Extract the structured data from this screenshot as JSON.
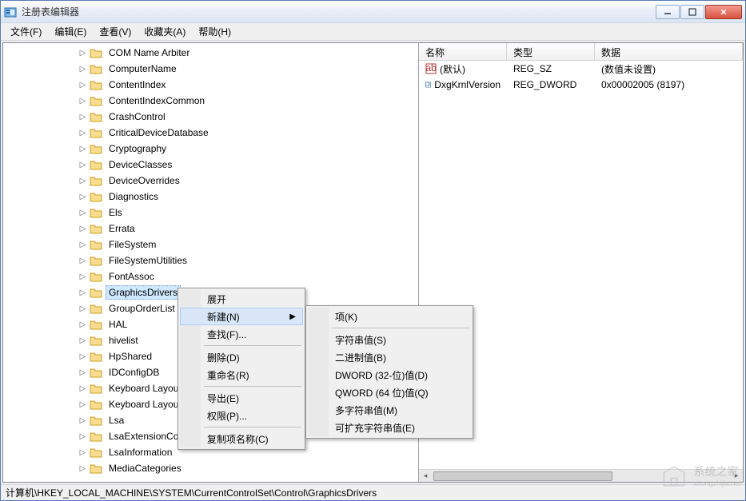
{
  "window": {
    "title": "注册表编辑器"
  },
  "menubar": [
    "文件(F)",
    "编辑(E)",
    "查看(V)",
    "收藏夹(A)",
    "帮助(H)"
  ],
  "tree": {
    "indent_base": 5,
    "items": [
      {
        "label": "COM Name Arbiter",
        "exp": false,
        "sel": false
      },
      {
        "label": "ComputerName",
        "exp": false,
        "sel": false
      },
      {
        "label": "ContentIndex",
        "exp": false,
        "sel": false
      },
      {
        "label": "ContentIndexCommon",
        "exp": false,
        "sel": false
      },
      {
        "label": "CrashControl",
        "exp": false,
        "sel": false
      },
      {
        "label": "CriticalDeviceDatabase",
        "exp": false,
        "sel": false
      },
      {
        "label": "Cryptography",
        "exp": false,
        "sel": false
      },
      {
        "label": "DeviceClasses",
        "exp": false,
        "sel": false
      },
      {
        "label": "DeviceOverrides",
        "exp": false,
        "sel": false
      },
      {
        "label": "Diagnostics",
        "exp": false,
        "sel": false
      },
      {
        "label": "Els",
        "exp": false,
        "sel": false
      },
      {
        "label": "Errata",
        "exp": false,
        "sel": false
      },
      {
        "label": "FileSystem",
        "exp": false,
        "sel": false
      },
      {
        "label": "FileSystemUtilities",
        "exp": false,
        "sel": false
      },
      {
        "label": "FontAssoc",
        "exp": false,
        "sel": false
      },
      {
        "label": "GraphicsDrivers",
        "exp": false,
        "sel": true
      },
      {
        "label": "GroupOrderList",
        "exp": false,
        "sel": false
      },
      {
        "label": "HAL",
        "exp": false,
        "sel": false
      },
      {
        "label": "hivelist",
        "exp": false,
        "sel": false
      },
      {
        "label": "HpShared",
        "exp": false,
        "sel": false
      },
      {
        "label": "IDConfigDB",
        "exp": false,
        "sel": false
      },
      {
        "label": "Keyboard Layout",
        "exp": false,
        "sel": false
      },
      {
        "label": "Keyboard Layouts",
        "exp": false,
        "sel": false
      },
      {
        "label": "Lsa",
        "exp": false,
        "sel": false
      },
      {
        "label": "LsaExtensionConfig",
        "exp": false,
        "sel": false
      },
      {
        "label": "LsaInformation",
        "exp": false,
        "sel": false
      },
      {
        "label": "MediaCategories",
        "exp": false,
        "sel": false
      }
    ]
  },
  "list": {
    "headers": {
      "name": "名称",
      "type": "类型",
      "data": "数据"
    },
    "col_widths": {
      "name": 110,
      "type": 110,
      "data": 180
    },
    "rows": [
      {
        "icon": "str",
        "name": "(默认)",
        "type": "REG_SZ",
        "data": "(数值未设置)"
      },
      {
        "icon": "bin",
        "name": "DxgKrnlVersion",
        "type": "REG_DWORD",
        "data": "0x00002005 (8197)"
      }
    ]
  },
  "statusbar": "计算机\\HKEY_LOCAL_MACHINE\\SYSTEM\\CurrentControlSet\\Control\\GraphicsDrivers",
  "ctx1": {
    "items": [
      {
        "label": "展开",
        "sep": false,
        "arrow": false,
        "hover": false
      },
      {
        "label": "新建(N)",
        "sep": false,
        "arrow": true,
        "hover": true
      },
      {
        "label": "查找(F)...",
        "sep": false,
        "arrow": false,
        "hover": false
      },
      {
        "sep": true
      },
      {
        "label": "删除(D)",
        "sep": false,
        "arrow": false,
        "hover": false
      },
      {
        "label": "重命名(R)",
        "sep": false,
        "arrow": false,
        "hover": false
      },
      {
        "sep": true
      },
      {
        "label": "导出(E)",
        "sep": false,
        "arrow": false,
        "hover": false
      },
      {
        "label": "权限(P)...",
        "sep": false,
        "arrow": false,
        "hover": false
      },
      {
        "sep": true
      },
      {
        "label": "复制项名称(C)",
        "sep": false,
        "arrow": false,
        "hover": false
      }
    ]
  },
  "ctx2": {
    "items": [
      {
        "label": "项(K)"
      },
      {
        "sep": true
      },
      {
        "label": "字符串值(S)"
      },
      {
        "label": "二进制值(B)"
      },
      {
        "label": "DWORD (32-位)值(D)",
        "boxed": true
      },
      {
        "label": "QWORD (64 位)值(Q)"
      },
      {
        "label": "多字符串值(M)"
      },
      {
        "label": "可扩充字符串值(E)"
      }
    ]
  },
  "watermark": "系统之家"
}
